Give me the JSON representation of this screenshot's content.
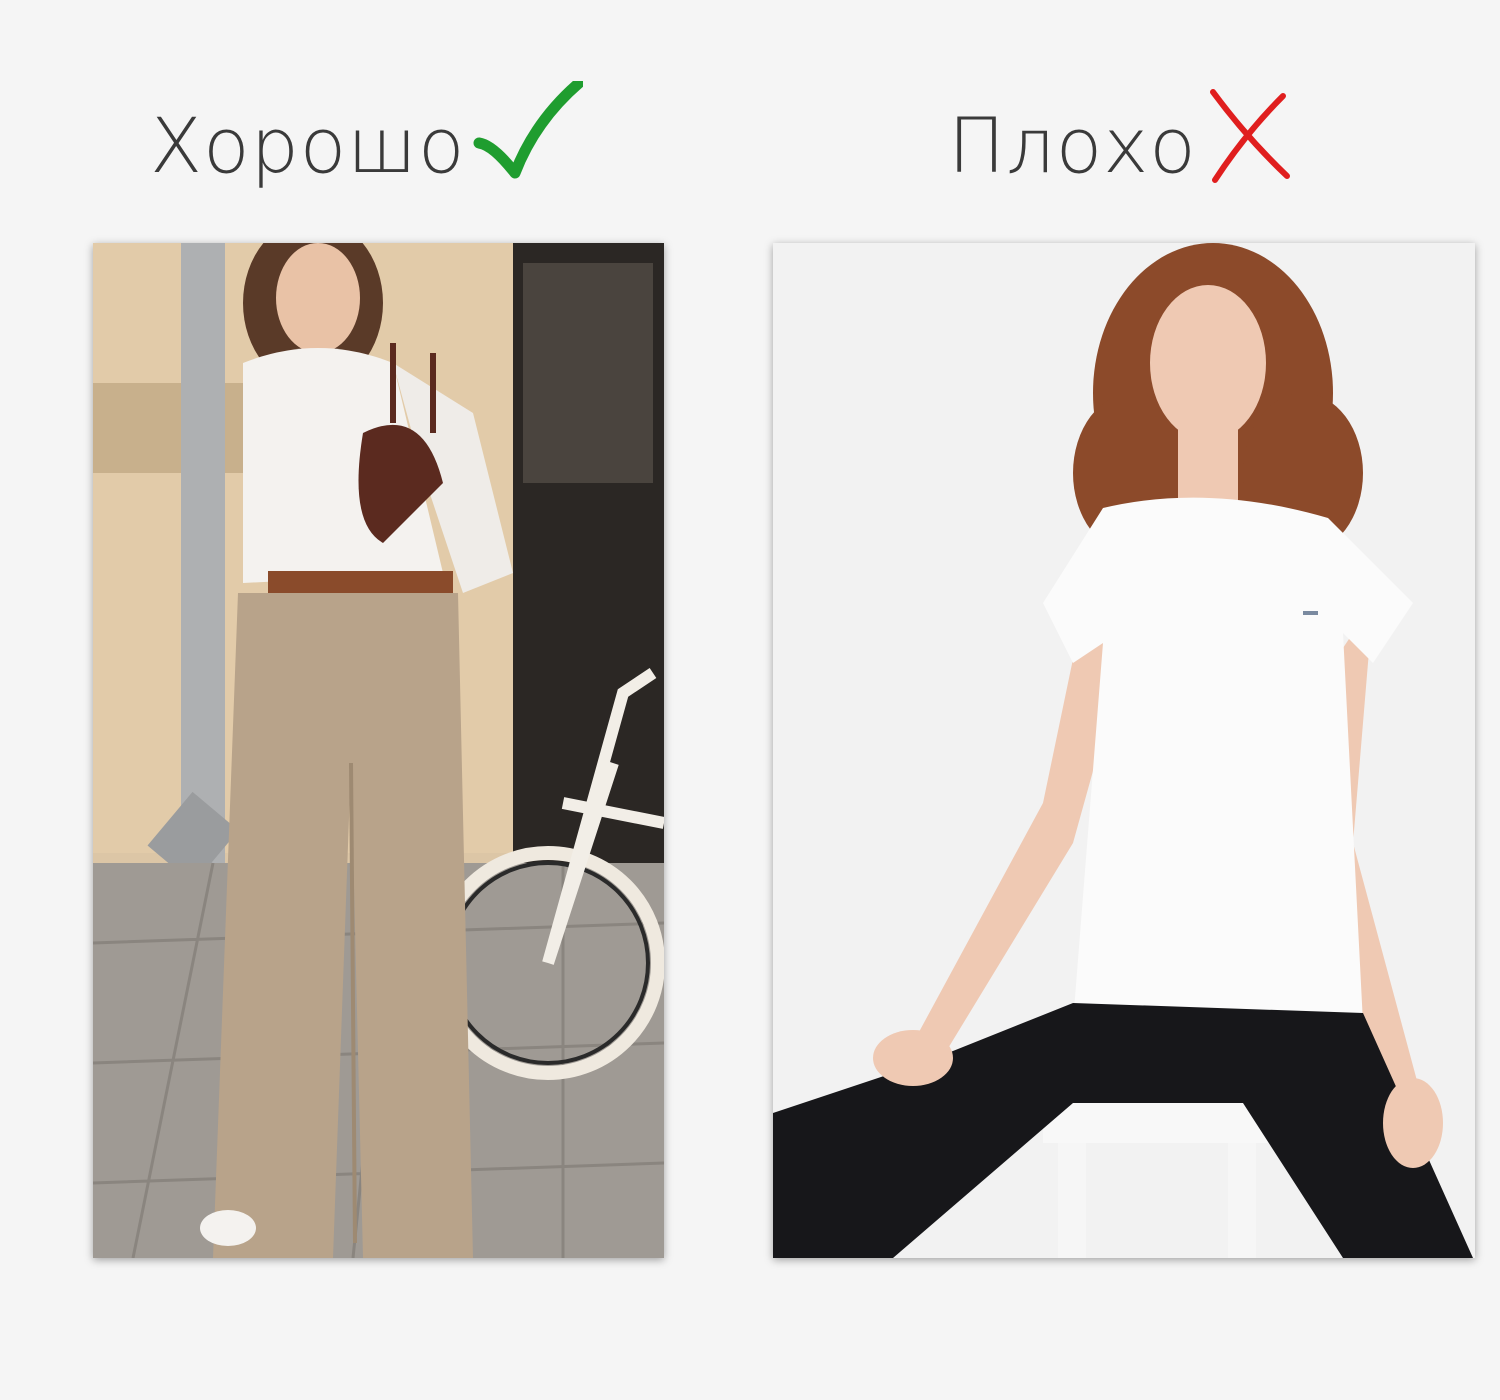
{
  "good": {
    "label": "Хорошо",
    "icon": "checkmark-icon",
    "icon_color": "#1f9d2f",
    "photo": "woman-white-shirt-beige-wide-trousers-bicycle-photo"
  },
  "bad": {
    "label": "Плохо",
    "icon": "cross-icon",
    "icon_color": "#e01e1e",
    "photo": "woman-white-tshirt-black-leggings-photo"
  },
  "colors": {
    "background": "#f5f5f5",
    "text": "#3a3a3a"
  }
}
